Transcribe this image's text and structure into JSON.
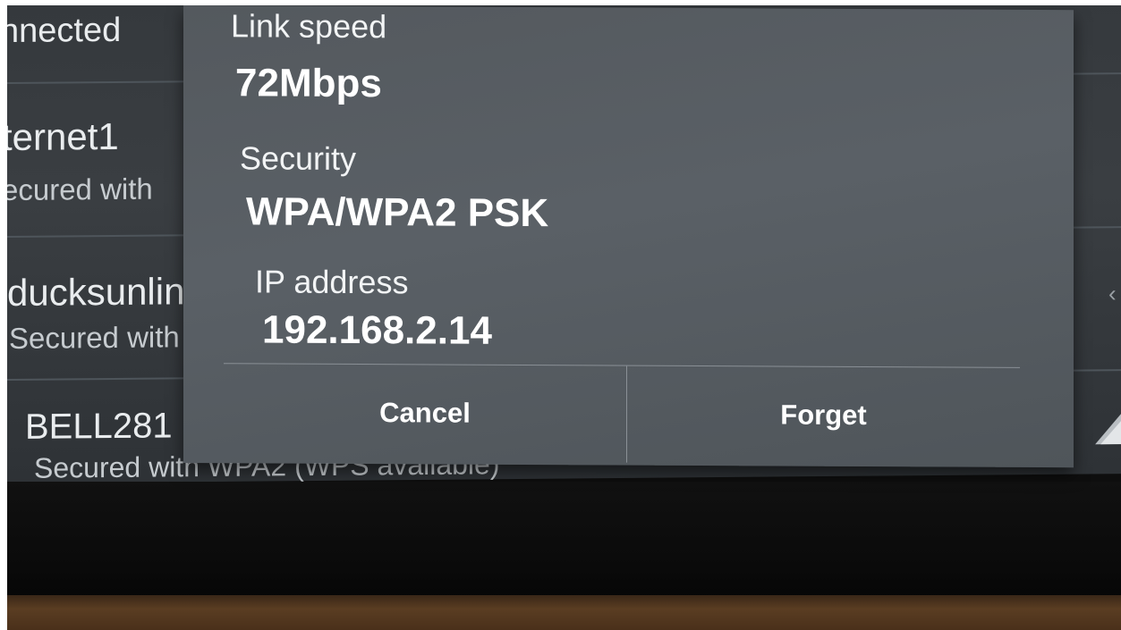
{
  "background_list": {
    "items": [
      {
        "title": "nnected",
        "subtitle": ""
      },
      {
        "title": "ternet1",
        "subtitle": "ecured with"
      },
      {
        "title": "ducksunlin",
        "subtitle": "Secured with"
      },
      {
        "title": "BELL281",
        "subtitle": "Secured with WPA2 (WPS available)"
      }
    ]
  },
  "dialog": {
    "fields": [
      {
        "label": "Link speed",
        "value": "72Mbps"
      },
      {
        "label": "Security",
        "value": "WPA/WPA2 PSK"
      },
      {
        "label": "IP address",
        "value": "192.168.2.14"
      }
    ],
    "cancel_label": "Cancel",
    "forget_label": "Forget"
  },
  "icons": {
    "wifi": "wifi-signal-icon",
    "edge_arrow": "chevron-icon"
  },
  "colors": {
    "dialog_bg": "#575d62",
    "screen_bg": "#363a3e",
    "text": "#ffffff"
  }
}
